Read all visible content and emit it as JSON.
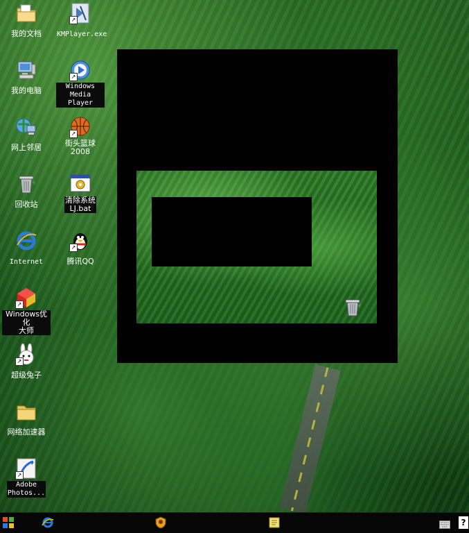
{
  "desktop": {
    "icons": [
      {
        "label": "我的文档",
        "icon": "folder-documents-icon"
      },
      {
        "label": "KMPlayer.exe",
        "icon": "kmplayer-icon"
      },
      {
        "label": "我的电脑",
        "icon": "my-computer-icon"
      },
      {
        "label": "Windows\nMedia Player",
        "icon": "windows-media-player-icon"
      },
      {
        "label": "网上邻居",
        "icon": "network-places-icon"
      },
      {
        "label": "街头篮球2008",
        "icon": "basketball-icon"
      },
      {
        "label": "回收站",
        "icon": "recycle-bin-icon"
      },
      {
        "label": "清除系统\nLJ.bat",
        "icon": "batch-file-icon"
      },
      {
        "label": "Internet",
        "icon": "internet-explorer-icon"
      },
      {
        "label": "腾讯QQ",
        "icon": "qq-penguin-icon"
      },
      {
        "label": "Windows优化\n大师",
        "icon": "windows-optimizer-icon"
      },
      {
        "label": "超级兔子",
        "icon": "super-rabbit-icon"
      },
      {
        "label": "网络加速器",
        "icon": "folder-icon"
      },
      {
        "label": "Adobe\nPhotos...",
        "icon": "adobe-photoshop-icon"
      }
    ]
  },
  "taskbar": {
    "start": "windows-start-icon",
    "ie": "internet-explorer-icon",
    "app": "shield-app-icon",
    "note": "sticky-note-icon",
    "keyboard": "keyboard-icon",
    "help": "?"
  }
}
